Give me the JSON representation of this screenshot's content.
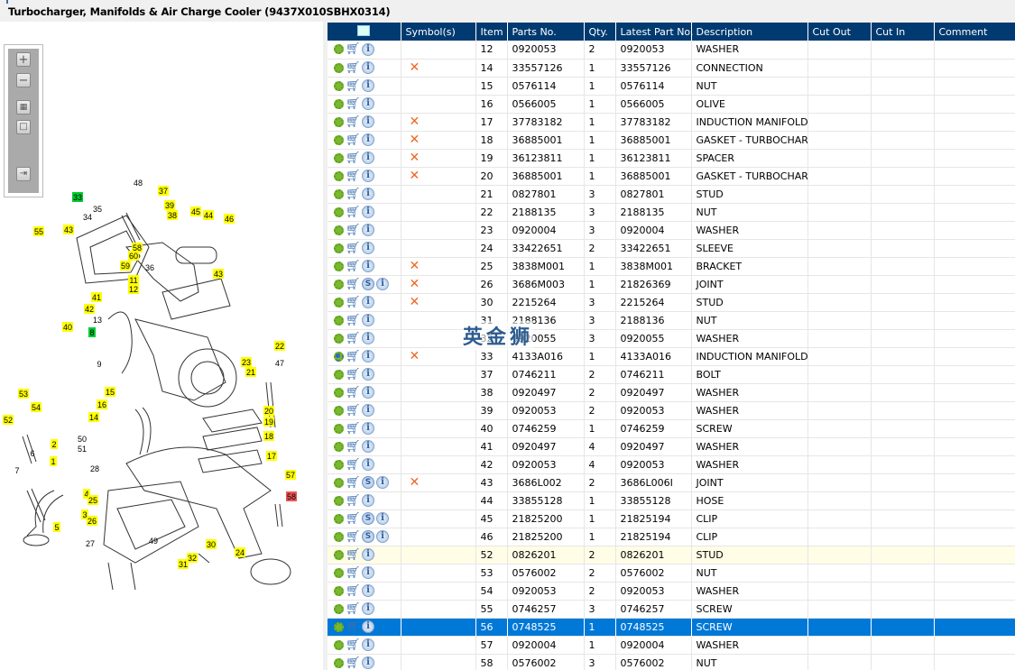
{
  "window": {
    "title": "Turbocharger, Manifolds & Air Charge Cooler (9437X010SBHX0314)"
  },
  "toolbar": {
    "zoom_in": "+",
    "zoom_out": "−",
    "fit_all": "fit",
    "actual": "box",
    "export": "export"
  },
  "watermark": "英金狮",
  "diagram": {
    "callouts": [
      {
        "n": "33",
        "c": "green"
      },
      {
        "n": "35",
        "c": "none"
      },
      {
        "n": "34",
        "c": "none"
      },
      {
        "n": "48",
        "c": "none"
      },
      {
        "n": "37",
        "c": "yellow"
      },
      {
        "n": "39",
        "c": "yellow"
      },
      {
        "n": "38",
        "c": "yellow"
      },
      {
        "n": "45",
        "c": "yellow"
      },
      {
        "n": "44",
        "c": "yellow"
      },
      {
        "n": "46",
        "c": "yellow"
      },
      {
        "n": "55",
        "c": "yellow"
      },
      {
        "n": "43",
        "c": "yellow"
      },
      {
        "n": "58",
        "c": "yellow"
      },
      {
        "n": "60",
        "c": "yellow"
      },
      {
        "n": "59",
        "c": "yellow"
      },
      {
        "n": "36",
        "c": "none"
      },
      {
        "n": "43",
        "c": "yellow"
      },
      {
        "n": "11",
        "c": "yellow"
      },
      {
        "n": "12",
        "c": "yellow"
      },
      {
        "n": "41",
        "c": "yellow"
      },
      {
        "n": "42",
        "c": "yellow"
      },
      {
        "n": "13",
        "c": "none"
      },
      {
        "n": "40",
        "c": "yellow"
      },
      {
        "n": "8",
        "c": "green"
      },
      {
        "n": "9",
        "c": "none"
      },
      {
        "n": "22",
        "c": "yellow"
      },
      {
        "n": "47",
        "c": "none"
      },
      {
        "n": "23",
        "c": "yellow"
      },
      {
        "n": "21",
        "c": "yellow"
      },
      {
        "n": "15",
        "c": "yellow"
      },
      {
        "n": "16",
        "c": "yellow"
      },
      {
        "n": "14",
        "c": "yellow"
      },
      {
        "n": "53",
        "c": "yellow"
      },
      {
        "n": "54",
        "c": "yellow"
      },
      {
        "n": "52",
        "c": "yellow"
      },
      {
        "n": "20",
        "c": "yellow"
      },
      {
        "n": "19",
        "c": "yellow"
      },
      {
        "n": "18",
        "c": "yellow"
      },
      {
        "n": "17",
        "c": "yellow"
      },
      {
        "n": "2",
        "c": "yellow"
      },
      {
        "n": "50",
        "c": "none"
      },
      {
        "n": "51",
        "c": "none"
      },
      {
        "n": "6",
        "c": "none"
      },
      {
        "n": "1",
        "c": "yellow"
      },
      {
        "n": "28",
        "c": "none"
      },
      {
        "n": "7",
        "c": "none"
      },
      {
        "n": "57",
        "c": "yellow"
      },
      {
        "n": "4",
        "c": "yellow"
      },
      {
        "n": "25",
        "c": "yellow"
      },
      {
        "n": "3",
        "c": "yellow"
      },
      {
        "n": "26",
        "c": "yellow"
      },
      {
        "n": "58",
        "c": "red"
      },
      {
        "n": "5",
        "c": "yellow"
      },
      {
        "n": "27",
        "c": "none"
      },
      {
        "n": "49",
        "c": "none"
      },
      {
        "n": "30",
        "c": "yellow"
      },
      {
        "n": "32",
        "c": "yellow"
      },
      {
        "n": "31",
        "c": "yellow"
      },
      {
        "n": "24",
        "c": "yellow"
      }
    ]
  },
  "colors": {
    "header_bg": "#003a70",
    "selected_bg": "#0078d7",
    "highlight_bg": "#fffde6",
    "symbol_x": "#f26522",
    "yellow": "#ffff00",
    "green": "#00cc33",
    "red": "#ee5555"
  },
  "table": {
    "columns": [
      "",
      "Symbol(s)",
      "Item",
      "Parts No.",
      "Qty.",
      "Latest Part No.",
      "Description",
      "Cut Out",
      "Cut In",
      "Comment"
    ],
    "rows": [
      {
        "item": "12",
        "part": "0920053",
        "qty": "2",
        "latest": "0920053",
        "desc": "WASHER",
        "x": false,
        "s": false
      },
      {
        "item": "14",
        "part": "33557126",
        "qty": "1",
        "latest": "33557126",
        "desc": "CONNECTION",
        "x": true,
        "s": false
      },
      {
        "item": "15",
        "part": "0576114",
        "qty": "1",
        "latest": "0576114",
        "desc": "NUT",
        "x": false,
        "s": false
      },
      {
        "item": "16",
        "part": "0566005",
        "qty": "1",
        "latest": "0566005",
        "desc": "OLIVE",
        "x": false,
        "s": false
      },
      {
        "item": "17",
        "part": "37783182",
        "qty": "1",
        "latest": "37783182",
        "desc": "INDUCTION MANIFOLD",
        "x": true,
        "s": false
      },
      {
        "item": "18",
        "part": "36885001",
        "qty": "1",
        "latest": "36885001",
        "desc": "GASKET - TURBOCHARGER",
        "x": true,
        "s": false
      },
      {
        "item": "19",
        "part": "36123811",
        "qty": "1",
        "latest": "36123811",
        "desc": "SPACER",
        "x": true,
        "s": false
      },
      {
        "item": "20",
        "part": "36885001",
        "qty": "1",
        "latest": "36885001",
        "desc": "GASKET - TURBOCHARGER",
        "x": true,
        "s": false
      },
      {
        "item": "21",
        "part": "0827801",
        "qty": "3",
        "latest": "0827801",
        "desc": "STUD",
        "x": false,
        "s": false
      },
      {
        "item": "22",
        "part": "2188135",
        "qty": "3",
        "latest": "2188135",
        "desc": "NUT",
        "x": false,
        "s": false
      },
      {
        "item": "23",
        "part": "0920004",
        "qty": "3",
        "latest": "0920004",
        "desc": "WASHER",
        "x": false,
        "s": false
      },
      {
        "item": "24",
        "part": "33422651",
        "qty": "2",
        "latest": "33422651",
        "desc": "SLEEVE",
        "x": false,
        "s": false
      },
      {
        "item": "25",
        "part": "3838M001",
        "qty": "1",
        "latest": "3838M001",
        "desc": "BRACKET",
        "x": true,
        "s": false
      },
      {
        "item": "26",
        "part": "3686M003",
        "qty": "1",
        "latest": "21826369",
        "desc": "JOINT",
        "x": true,
        "s": true
      },
      {
        "item": "30",
        "part": "2215264",
        "qty": "3",
        "latest": "2215264",
        "desc": "STUD",
        "x": true,
        "s": false
      },
      {
        "item": "31",
        "part": "2188136",
        "qty": "3",
        "latest": "2188136",
        "desc": "NUT",
        "x": false,
        "s": false
      },
      {
        "item": "32",
        "part": "0920055",
        "qty": "3",
        "latest": "0920055",
        "desc": "WASHER",
        "x": false,
        "s": false
      },
      {
        "item": "33",
        "part": "4133A016",
        "qty": "1",
        "latest": "4133A016",
        "desc": "INDUCTION MANIFOLD",
        "x": true,
        "s": false,
        "blue": true
      },
      {
        "item": "37",
        "part": "0746211",
        "qty": "2",
        "latest": "0746211",
        "desc": "BOLT",
        "x": false,
        "s": false
      },
      {
        "item": "38",
        "part": "0920497",
        "qty": "2",
        "latest": "0920497",
        "desc": "WASHER",
        "x": false,
        "s": false
      },
      {
        "item": "39",
        "part": "0920053",
        "qty": "2",
        "latest": "0920053",
        "desc": "WASHER",
        "x": false,
        "s": false
      },
      {
        "item": "40",
        "part": "0746259",
        "qty": "1",
        "latest": "0746259",
        "desc": "SCREW",
        "x": false,
        "s": false
      },
      {
        "item": "41",
        "part": "0920497",
        "qty": "4",
        "latest": "0920497",
        "desc": "WASHER",
        "x": false,
        "s": false
      },
      {
        "item": "42",
        "part": "0920053",
        "qty": "4",
        "latest": "0920053",
        "desc": "WASHER",
        "x": false,
        "s": false
      },
      {
        "item": "43",
        "part": "3686L002",
        "qty": "2",
        "latest": "3686L006I",
        "desc": "JOINT",
        "x": true,
        "s": true
      },
      {
        "item": "44",
        "part": "33855128",
        "qty": "1",
        "latest": "33855128",
        "desc": "HOSE",
        "x": false,
        "s": false
      },
      {
        "item": "45",
        "part": "21825200",
        "qty": "1",
        "latest": "21825194",
        "desc": "CLIP",
        "x": false,
        "s": true
      },
      {
        "item": "46",
        "part": "21825200",
        "qty": "1",
        "latest": "21825194",
        "desc": "CLIP",
        "x": false,
        "s": true
      },
      {
        "item": "52",
        "part": "0826201",
        "qty": "2",
        "latest": "0826201",
        "desc": "STUD",
        "x": false,
        "s": false,
        "state": "hl"
      },
      {
        "item": "53",
        "part": "0576002",
        "qty": "2",
        "latest": "0576002",
        "desc": "NUT",
        "x": false,
        "s": false
      },
      {
        "item": "54",
        "part": "0920053",
        "qty": "2",
        "latest": "0920053",
        "desc": "WASHER",
        "x": false,
        "s": false
      },
      {
        "item": "55",
        "part": "0746257",
        "qty": "3",
        "latest": "0746257",
        "desc": "SCREW",
        "x": false,
        "s": false
      },
      {
        "item": "56",
        "part": "0748525",
        "qty": "1",
        "latest": "0748525",
        "desc": "SCREW",
        "x": false,
        "s": false,
        "state": "sel"
      },
      {
        "item": "57",
        "part": "0920004",
        "qty": "1",
        "latest": "0920004",
        "desc": "WASHER",
        "x": false,
        "s": false
      },
      {
        "item": "58",
        "part": "0576002",
        "qty": "3",
        "latest": "0576002",
        "desc": "NUT",
        "x": false,
        "s": false
      }
    ],
    "s_label": "S",
    "info_label": "i",
    "x_label": "✕"
  }
}
